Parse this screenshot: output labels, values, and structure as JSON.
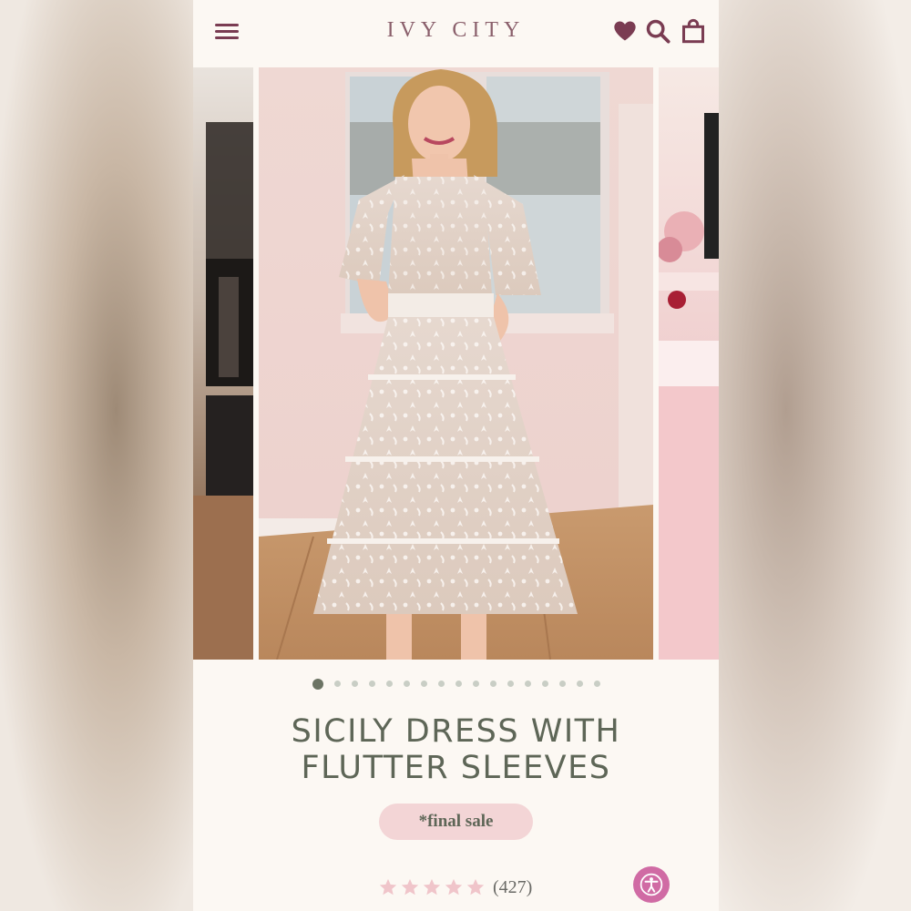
{
  "header": {
    "brand": "IVY CITY",
    "icons": [
      "menu-icon",
      "heart-icon",
      "search-icon",
      "bag-icon"
    ]
  },
  "gallery": {
    "slide_count": 17,
    "active_index": 0
  },
  "product": {
    "title": "SICILY DRESS WITH FLUTTER SLEEVES",
    "badge": "*final sale",
    "rating": 5,
    "review_count": "(427)"
  },
  "colors": {
    "accent": "#7a3c52",
    "title_green": "#5e6657",
    "badge_pink": "#f3d5d6",
    "star_pink": "#f0c5ca",
    "a11y_pink": "#d06ba4"
  }
}
